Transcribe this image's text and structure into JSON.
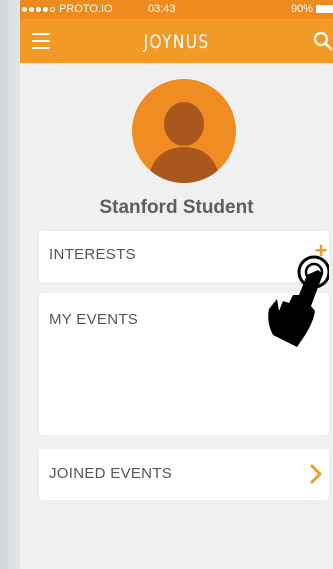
{
  "status_bar": {
    "carrier": "PROTO.IO",
    "time": "03:43",
    "battery": "90%"
  },
  "header": {
    "title": "JOYNUS",
    "menu_icon": "hamburger-menu-icon",
    "search_icon": "search-icon"
  },
  "profile": {
    "name": "Stanford Student",
    "avatar_icon": "user-silhouette-icon"
  },
  "sections": {
    "interests": {
      "label": "INTERESTS",
      "action_glyph": "+"
    },
    "my_events": {
      "label": "MY EVENTS"
    },
    "joined_events": {
      "label": "JOINED EVENTS",
      "action_icon": "chevron-right-icon"
    }
  },
  "overlay": {
    "icon": "tap-hand-icon"
  },
  "colors": {
    "accent": "#f19a25",
    "status_bar": "#ee8b1f",
    "background": "#f0f0f0",
    "card": "#ffffff",
    "text": "#565656"
  }
}
